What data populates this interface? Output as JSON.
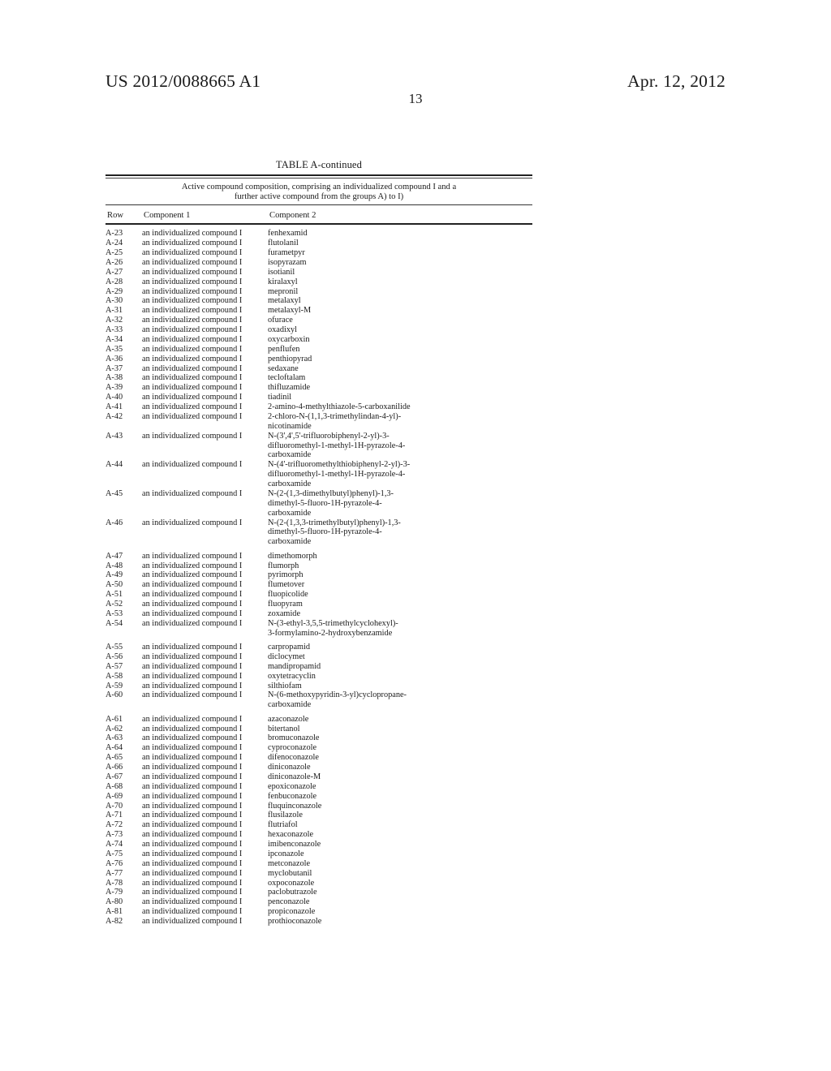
{
  "header": {
    "publication_number": "US 2012/0088665 A1",
    "publication_date": "Apr. 12, 2012",
    "page_number": "13"
  },
  "table": {
    "caption": "TABLE A-continued",
    "subtitle_line1": "Active compound composition, comprising an individualized compound I and a",
    "subtitle_line2": "further active compound from the groups A) to I)",
    "columns": {
      "row": "Row",
      "component1": "Component 1",
      "component2": "Component 2"
    },
    "component1_default": "an individualized compound I",
    "groups": [
      {
        "rows": [
          {
            "row": "A-23",
            "component1": "an individualized compound I",
            "component2": [
              "fenhexamid"
            ]
          },
          {
            "row": "A-24",
            "component1": "an individualized compound I",
            "component2": [
              "flutolanil"
            ]
          },
          {
            "row": "A-25",
            "component1": "an individualized compound I",
            "component2": [
              "furametpyr"
            ]
          },
          {
            "row": "A-26",
            "component1": "an individualized compound I",
            "component2": [
              "isopyrazam"
            ]
          },
          {
            "row": "A-27",
            "component1": "an individualized compound I",
            "component2": [
              "isotianil"
            ]
          },
          {
            "row": "A-28",
            "component1": "an individualized compound I",
            "component2": [
              "kiralaxyl"
            ]
          },
          {
            "row": "A-29",
            "component1": "an individualized compound I",
            "component2": [
              "mepronil"
            ]
          },
          {
            "row": "A-30",
            "component1": "an individualized compound I",
            "component2": [
              "metalaxyl"
            ]
          },
          {
            "row": "A-31",
            "component1": "an individualized compound I",
            "component2": [
              "metalaxyl-M"
            ]
          },
          {
            "row": "A-32",
            "component1": "an individualized compound I",
            "component2": [
              "ofurace"
            ]
          },
          {
            "row": "A-33",
            "component1": "an individualized compound I",
            "component2": [
              "oxadixyl"
            ]
          },
          {
            "row": "A-34",
            "component1": "an individualized compound I",
            "component2": [
              "oxycarboxin"
            ]
          },
          {
            "row": "A-35",
            "component1": "an individualized compound I",
            "component2": [
              "penflufen"
            ]
          },
          {
            "row": "A-36",
            "component1": "an individualized compound I",
            "component2": [
              "penthiopyrad"
            ]
          },
          {
            "row": "A-37",
            "component1": "an individualized compound I",
            "component2": [
              "sedaxane"
            ]
          },
          {
            "row": "A-38",
            "component1": "an individualized compound I",
            "component2": [
              "tecloftalam"
            ]
          },
          {
            "row": "A-39",
            "component1": "an individualized compound I",
            "component2": [
              "thifluzamide"
            ]
          },
          {
            "row": "A-40",
            "component1": "an individualized compound I",
            "component2": [
              "tiadinil"
            ]
          },
          {
            "row": "A-41",
            "component1": "an individualized compound I",
            "component2": [
              "2-amino-4-methylthiazole-5-carboxanilide"
            ]
          },
          {
            "row": "A-42",
            "component1": "an individualized compound I",
            "component2": [
              "2-chloro-N-(1,1,3-trimethylindan-4-yl)-",
              "nicotinamide"
            ]
          },
          {
            "row": "A-43",
            "component1": "an individualized compound I",
            "component2": [
              "N-(3',4',5'-trifluorobiphenyl-2-yl)-3-",
              "difluoromethyl-1-methyl-1H-pyrazole-4-",
              "carboxamide"
            ]
          },
          {
            "row": "A-44",
            "component1": "an individualized compound I",
            "component2": [
              "N-(4'-trifluoromethylthiobiphenyl-2-yl)-3-",
              "difluoromethyl-1-methyl-1H-pyrazole-4-",
              "carboxamide"
            ]
          },
          {
            "row": "A-45",
            "component1": "an individualized compound I",
            "component2": [
              "N-(2-(1,3-dimethylbutyl)phenyl)-1,3-",
              "dimethyl-5-fluoro-1H-pyrazole-4-",
              "carboxamide"
            ]
          },
          {
            "row": "A-46",
            "component1": "an individualized compound I",
            "component2": [
              "N-(2-(1,3,3-trimethylbutyl)phenyl)-1,3-",
              "dimethyl-5-fluoro-1H-pyrazole-4-",
              "carboxamide"
            ]
          }
        ]
      },
      {
        "rows": [
          {
            "row": "A-47",
            "component1": "an individualized compound I",
            "component2": [
              "dimethomorph"
            ]
          },
          {
            "row": "A-48",
            "component1": "an individualized compound I",
            "component2": [
              "flumorph"
            ]
          },
          {
            "row": "A-49",
            "component1": "an individualized compound I",
            "component2": [
              "pyrimorph"
            ]
          },
          {
            "row": "A-50",
            "component1": "an individualized compound I",
            "component2": [
              "flumetover"
            ]
          },
          {
            "row": "A-51",
            "component1": "an individualized compound I",
            "component2": [
              "fluopicolide"
            ]
          },
          {
            "row": "A-52",
            "component1": "an individualized compound I",
            "component2": [
              "fluopyram"
            ]
          },
          {
            "row": "A-53",
            "component1": "an individualized compound I",
            "component2": [
              "zoxamide"
            ]
          },
          {
            "row": "A-54",
            "component1": "an individualized compound I",
            "component2": [
              "N-(3-ethyl-3,5,5-trimethylcyclohexyl)-",
              "3-formylamino-2-hydroxybenzamide"
            ]
          }
        ]
      },
      {
        "rows": [
          {
            "row": "A-55",
            "component1": "an individualized compound I",
            "component2": [
              "carpropamid"
            ]
          },
          {
            "row": "A-56",
            "component1": "an individualized compound I",
            "component2": [
              "diclocymet"
            ]
          },
          {
            "row": "A-57",
            "component1": "an individualized compound I",
            "component2": [
              "mandipropamid"
            ]
          },
          {
            "row": "A-58",
            "component1": "an individualized compound I",
            "component2": [
              "oxytetracyclin"
            ]
          },
          {
            "row": "A-59",
            "component1": "an individualized compound I",
            "component2": [
              "silthiofam"
            ]
          },
          {
            "row": "A-60",
            "component1": "an individualized compound I",
            "component2": [
              "N-(6-methoxypyridin-3-yl)cyclopropane-",
              "carboxamide"
            ]
          }
        ]
      },
      {
        "rows": [
          {
            "row": "A-61",
            "component1": "an individualized compound I",
            "component2": [
              "azaconazole"
            ]
          },
          {
            "row": "A-62",
            "component1": "an individualized compound I",
            "component2": [
              "bitertanol"
            ]
          },
          {
            "row": "A-63",
            "component1": "an individualized compound I",
            "component2": [
              "bromuconazole"
            ]
          },
          {
            "row": "A-64",
            "component1": "an individualized compound I",
            "component2": [
              "cyproconazole"
            ]
          },
          {
            "row": "A-65",
            "component1": "an individualized compound I",
            "component2": [
              "difenoconazole"
            ]
          },
          {
            "row": "A-66",
            "component1": "an individualized compound I",
            "component2": [
              "diniconazole"
            ]
          },
          {
            "row": "A-67",
            "component1": "an individualized compound I",
            "component2": [
              "diniconazole-M"
            ]
          },
          {
            "row": "A-68",
            "component1": "an individualized compound I",
            "component2": [
              "epoxiconazole"
            ]
          },
          {
            "row": "A-69",
            "component1": "an individualized compound I",
            "component2": [
              "fenbuconazole"
            ]
          },
          {
            "row": "A-70",
            "component1": "an individualized compound I",
            "component2": [
              "fluquinconazole"
            ]
          },
          {
            "row": "A-71",
            "component1": "an individualized compound I",
            "component2": [
              "flusilazole"
            ]
          },
          {
            "row": "A-72",
            "component1": "an individualized compound I",
            "component2": [
              "flutriafol"
            ]
          },
          {
            "row": "A-73",
            "component1": "an individualized compound I",
            "component2": [
              "hexaconazole"
            ]
          },
          {
            "row": "A-74",
            "component1": "an individualized compound I",
            "component2": [
              "imibenconazole"
            ]
          },
          {
            "row": "A-75",
            "component1": "an individualized compound I",
            "component2": [
              "ipconazole"
            ]
          },
          {
            "row": "A-76",
            "component1": "an individualized compound I",
            "component2": [
              "metconazole"
            ]
          },
          {
            "row": "A-77",
            "component1": "an individualized compound I",
            "component2": [
              "myclobutanil"
            ]
          },
          {
            "row": "A-78",
            "component1": "an individualized compound I",
            "component2": [
              "oxpoconazole"
            ]
          },
          {
            "row": "A-79",
            "component1": "an individualized compound I",
            "component2": [
              "paclobutrazole"
            ]
          },
          {
            "row": "A-80",
            "component1": "an individualized compound I",
            "component2": [
              "penconazole"
            ]
          },
          {
            "row": "A-81",
            "component1": "an individualized compound I",
            "component2": [
              "propiconazole"
            ]
          },
          {
            "row": "A-82",
            "component1": "an individualized compound I",
            "component2": [
              "prothioconazole"
            ]
          }
        ]
      }
    ]
  }
}
